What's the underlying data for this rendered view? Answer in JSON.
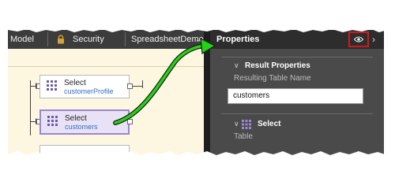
{
  "tabs": {
    "model": "Model",
    "security": "Security",
    "spreadsheet_demo": "SpreadsheetDemo",
    "back_arrow": "←"
  },
  "nodes": [
    {
      "title": "Select",
      "subtitle": "customerProfile",
      "selected": false
    },
    {
      "title": "Select",
      "subtitle": "customers",
      "selected": true
    }
  ],
  "panel": {
    "title": "Properties",
    "chevron": "›",
    "result_section": "Result Properties",
    "result_table_label": "Resulting Table Name",
    "result_table_value": "customers",
    "select_section": "Select",
    "table_label": "Table",
    "section_chevron": "∨"
  },
  "colors": {
    "highlight_box": "#d01a1a",
    "annotation_arrow": "#22d414",
    "selected_node": "#9b86cf",
    "link": "#2f6fc6"
  },
  "icons": {
    "lock": "lock-icon",
    "eye": "eye-icon",
    "table": "table-grid-icon"
  }
}
